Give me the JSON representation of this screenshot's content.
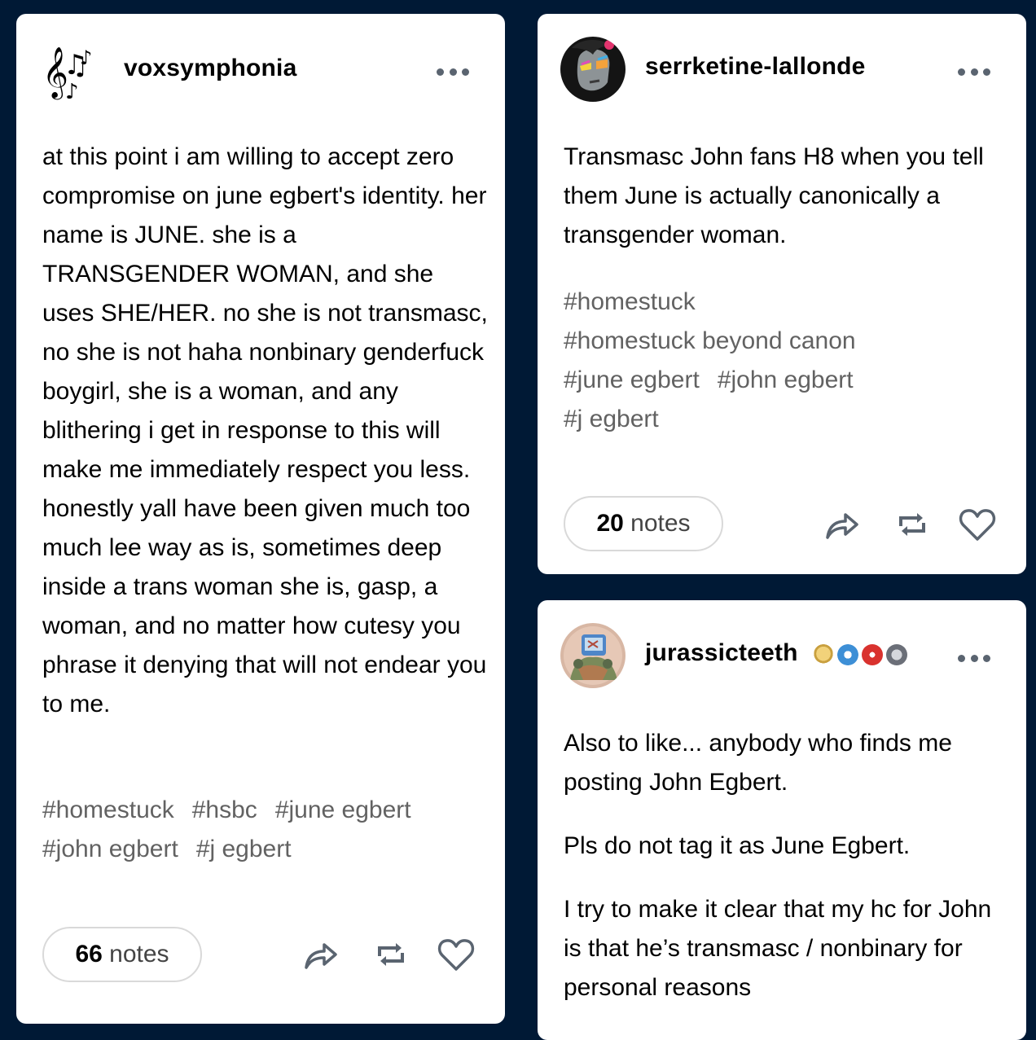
{
  "posts": [
    {
      "username": "voxsymphonia",
      "avatar_icon": "music-notes-icon",
      "paragraphs": [
        "at this point i am willing to accept zero compromise on june egbert's identity. her name is JUNE. she is a TRANSGENDER WOMAN, and she uses SHE/HER. no she is not transmasc, no she is not haha nonbinary genderfuck boygirl, she is a woman, and any blithering i get in response to this will make me immediately respect you less. honestly yall have been given much too much lee way as is, sometimes deep inside a trans woman she is, gasp, a woman, and no matter how cutesy you phrase it denying that will not endear you to me."
      ],
      "tags": [
        "#homestuck",
        "#hsbc",
        "#june egbert",
        "#john egbert",
        "#j egbert"
      ],
      "notes_count": "66",
      "notes_label": "notes"
    },
    {
      "username": "serrketine-lallonde",
      "avatar_icon": "character-avatar-icon",
      "paragraphs": [
        "Transmasc John fans H8 when you tell them June is actually canonically a transgender woman."
      ],
      "tags": [
        "#homestuck",
        "#homestuck beyond canon",
        "#june egbert",
        "#john egbert",
        "#j egbert"
      ],
      "notes_count": "20",
      "notes_label": "notes"
    },
    {
      "username": "jurassicteeth",
      "avatar_icon": "character-avatar-icon",
      "badges": [
        "straw-hat-badge-icon",
        "chattering-teeth-badge-icon",
        "dice-badge-icon",
        "mask-badge-icon"
      ],
      "paragraphs": [
        "Also to like... anybody who finds me posting John Egbert.",
        "Pls do not tag it as June Egbert.",
        "I try to make it clear that my hc for John is that he’s transmasc / nonbinary for personal reasons"
      ]
    }
  ],
  "colors": {
    "background": "#001935",
    "card": "#ffffff",
    "tag_text": "#626262",
    "icon": "#5a6470"
  }
}
